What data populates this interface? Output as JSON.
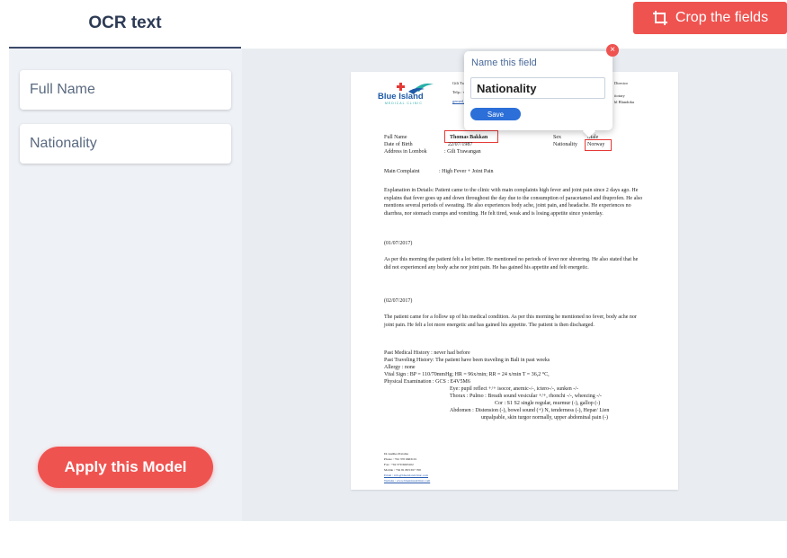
{
  "tab": {
    "label": "OCR text"
  },
  "toolbar": {
    "crop_label": "Crop the fields",
    "crop_icon": "crop-icon"
  },
  "fields": [
    {
      "label": "Full Name"
    },
    {
      "label": "Nationality"
    }
  ],
  "apply_label": "Apply this Model",
  "popup": {
    "title": "Name this field",
    "value": "Nationality",
    "save_label": "Save",
    "close_icon": "close-icon",
    "close_glyph": "×"
  },
  "document": {
    "logo": {
      "text": "Blue Island",
      "subtitle": "MEDICAL CLINIC"
    },
    "header_left": [
      "Gili Trawan",
      "Telp.: +62(0",
      "gemed_cli"
    ],
    "header_right": [
      "Director",
      "iiotary",
      "bl Blandoku"
    ],
    "patient": {
      "full_name_label": "Full Name",
      "full_name_value": "Thomas Bakkan",
      "dob_label": "Date of Birth",
      "dob_value": "22/07/1987",
      "address_label": "Address in Lombok",
      "address_value": ": Gili Trawangan",
      "sex_label": "Sex",
      "sex_value": "Male",
      "nationality_label": "Nationality",
      "nationality_value": "Norway"
    },
    "complaint_label": "Main Complaint",
    "complaint_value": ":   High Fever + Joint Pain",
    "explanation": "Explanation in Details: Patient came to the clinic with main complaints high fever and joint pain since 2 days ago. He explains that fever goes up and down throughout the day due to the consumption of paracetamol and ibuprofen. He also mentions several periods of sweating. He also experiences body ache, joint pain, and headache. He experiences no diarrhea, nor stomach cramps and vomiting. He felt tired, weak and is losing appetite since yesterday.",
    "date1": "(01/07/2017)",
    "para1": "As per this morning the patient felt a lot better. He mentioned no periods of fever nor shivering. He also stated that he did not experienced any body ache nor joint pain. He has gained his appetite and felt energetic.",
    "date2": "(02/07/2017)",
    "para2": "The patient came for a follow up of his medical condition. As per this morning he mentioned no fever, body ache nor joint pain. He felt a lot more energetic and has gained his appetite. The patient is then discharged.",
    "history": [
      "Past Medical History  : never had before",
      "Past Traveling History: The patient have been traveling in Bali in past weeks",
      "Allergy                      : none",
      "Vital Sign                  : BP = 110/70mmHg; HR = 96x/min; RR = 24 x/min  T = 36,2 °C,",
      "Physical Examination  : GCS : E4V5M6",
      "Eye: pupil reflect +/+ isocor, anemic-/-, ictero-/-, sunken -/-",
      "Thorax : Pulmo : Breath sound vesicular +/+, rhonchi -/-, wheezing -/-",
      "Cor : S1 S2 single regular, murmur (-), gallop (-)",
      "Abdomen : Distension (-), bowel sound (+) N, tenderness (-), Hepar/ Lien",
      "unpalpable, skin turgor normally, upper abdominal pain (-)"
    ],
    "footer": [
      "Dr Andika Pratama",
      "Phone  : +62 370 6663101",
      "Fax      : +62 370 6663102",
      "Mobile : +62 81 803 657 700",
      "Email   : info@blueislandclinic.com",
      "Website : www.blueislandclinic.com"
    ]
  },
  "colors": {
    "accent": "#ef5350",
    "primary": "#2c6fd8",
    "panel_bg": "#eef1f6"
  }
}
